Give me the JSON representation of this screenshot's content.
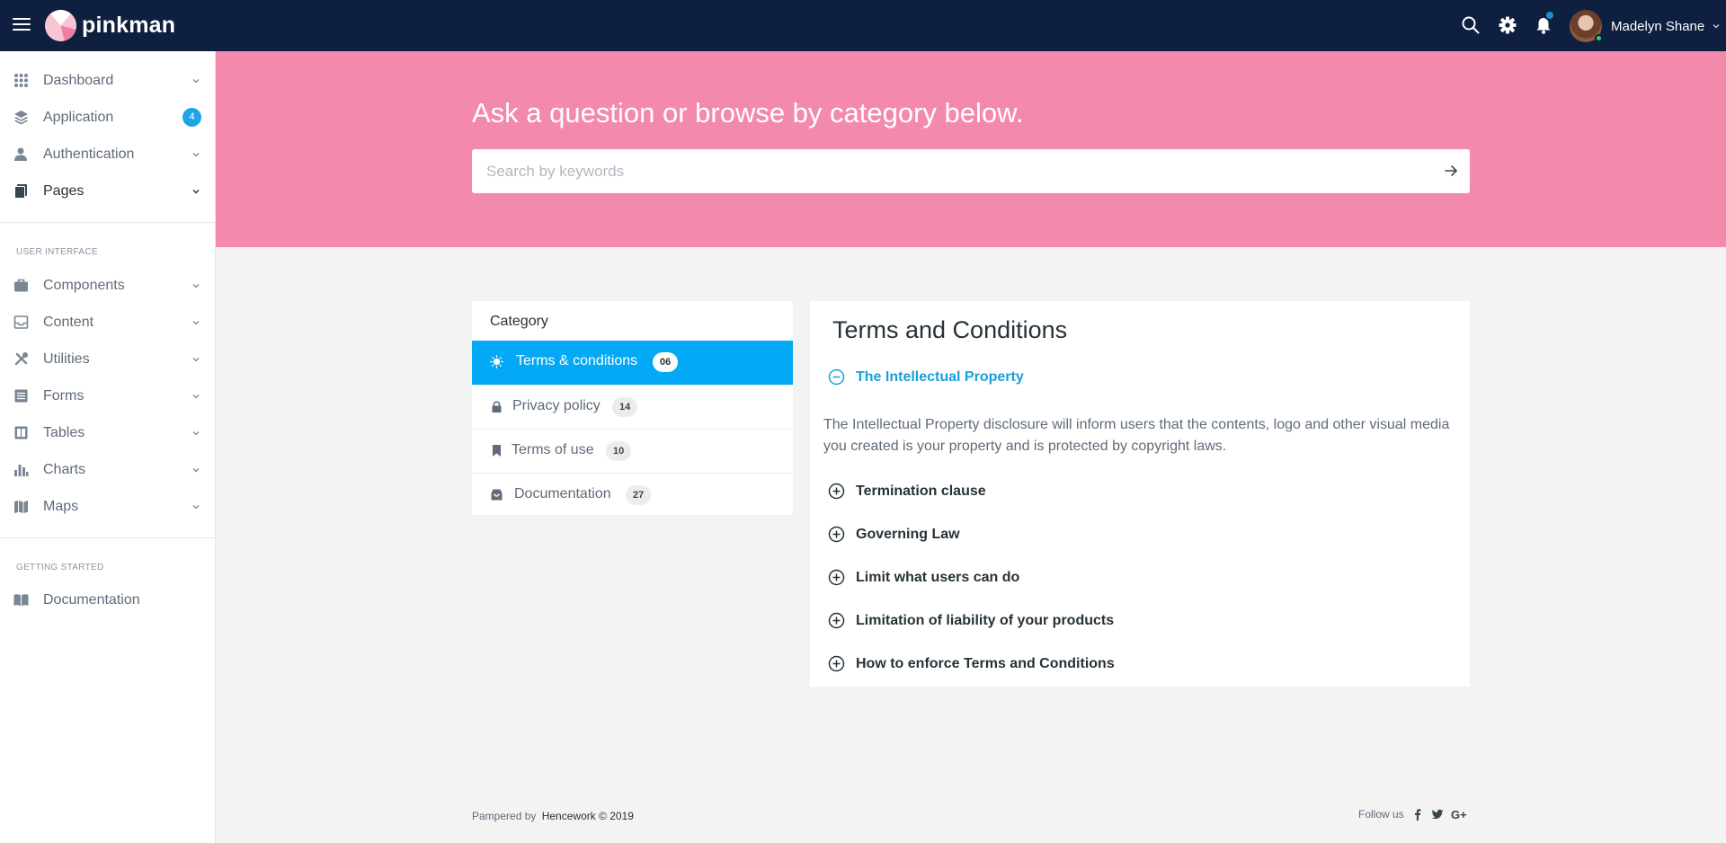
{
  "header": {
    "brand": "pinkman",
    "user_name": "Madelyn Shane",
    "icons": [
      "menu-icon",
      "search-icon",
      "gear-icon",
      "bell-icon",
      "chevron-down-icon"
    ]
  },
  "sidebar": {
    "items": [
      {
        "label": "Dashboard",
        "icon": "grid-icon"
      },
      {
        "label": "Application",
        "icon": "layers-icon",
        "badge": "4"
      },
      {
        "label": "Authentication",
        "icon": "user-icon"
      },
      {
        "label": "Pages",
        "icon": "pages-icon"
      },
      {
        "label": "Components",
        "icon": "briefcase-icon"
      },
      {
        "label": "Content",
        "icon": "inbox-icon"
      },
      {
        "label": "Utilities",
        "icon": "tools-icon"
      },
      {
        "label": "Forms",
        "icon": "list-icon"
      },
      {
        "label": "Tables",
        "icon": "table-icon"
      },
      {
        "label": "Charts",
        "icon": "bar-chart-icon"
      },
      {
        "label": "Maps",
        "icon": "map-icon"
      },
      {
        "label": "Documentation",
        "icon": "book-icon"
      }
    ],
    "sections": {
      "ui": "USER INTERFACE",
      "getting_started": "GETTING STARTED"
    }
  },
  "hero": {
    "title": "Ask a question or browse by category below.",
    "search_placeholder": "Search by keywords"
  },
  "category": {
    "title": "Category",
    "items": [
      {
        "label": "Terms & conditions",
        "count": "06",
        "active": true,
        "icon": "sun-icon"
      },
      {
        "label": "Privacy policy",
        "count": "14",
        "active": false,
        "icon": "lock-icon"
      },
      {
        "label": "Terms of use",
        "count": "10",
        "active": false,
        "icon": "bookmark-icon"
      },
      {
        "label": "Documentation",
        "count": "27",
        "active": false,
        "icon": "archive-icon"
      }
    ]
  },
  "terms": {
    "title": "Terms and Conditions",
    "open_item": {
      "label": "The Intellectual Property",
      "body": "The Intellectual Property disclosure will inform users that the contents, logo and other visual media you created is your property and is protected by copyright laws."
    },
    "items": [
      "Termination clause",
      "Governing Law",
      "Limit what users can do",
      "Limitation of liability of your products",
      "How to enforce Terms and Conditions"
    ]
  },
  "footer": {
    "pampered_by": "Pampered by",
    "company": "Hencework © 2019",
    "follow_us": "Follow us"
  },
  "colors": {
    "topbar": "#0f1f40",
    "hero": "#f48aab",
    "active_category": "#03a9f4",
    "accent_link": "#1a9fd9",
    "badge": "#1ea5e8"
  }
}
